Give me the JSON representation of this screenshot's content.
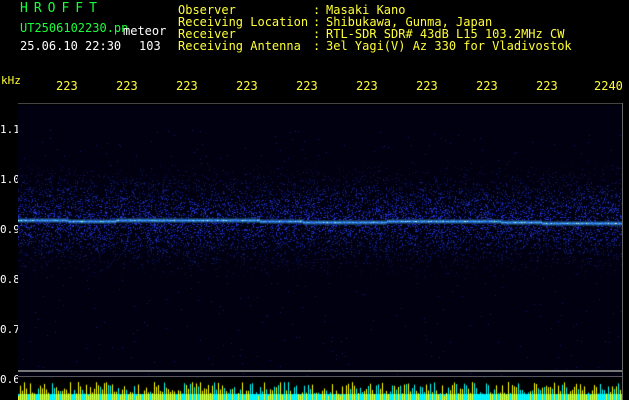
{
  "header": {
    "logo": "HROFFT",
    "filename": "UT2506102230.pn",
    "meteor_label": "meteor",
    "datetime": "25.06.10 22:30",
    "count": "103"
  },
  "info": [
    {
      "label": "Observer",
      "sep": ":",
      "value": "Masaki Kano"
    },
    {
      "label": "Receiving Location",
      "sep": ":",
      "value": "Shibukawa, Gunma, Japan"
    },
    {
      "label": "Receiver",
      "sep": ":",
      "value": "RTL-SDR SDR# 43dB L15 103.2MHz CW"
    },
    {
      "label": "Receiving Antenna",
      "sep": ":",
      "value": "3el Yagi(V) Az 330 for Vladivostok"
    }
  ],
  "y_axis": {
    "unit": "kHz",
    "ticks": [
      "1.1",
      "1.0",
      "0.9",
      "0.8",
      "0.7",
      "0.6"
    ]
  },
  "x_axis": {
    "ticks": [
      "223",
      "223",
      "223",
      "223",
      "223",
      "223",
      "223",
      "223",
      "223",
      "2240"
    ]
  },
  "spectrogram": {
    "band_freq_khz": 0.92,
    "noise_band_khz": [
      0.8,
      1.0
    ],
    "colors": {
      "background": "#000010",
      "trace": "#4fe0ff",
      "noise": "#2230c8",
      "bars_cyan": "#00ffff",
      "bars_yellow": "#ffff00"
    }
  }
}
